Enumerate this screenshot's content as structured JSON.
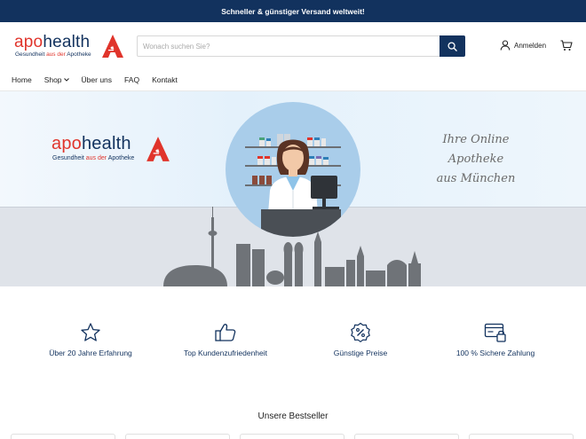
{
  "topbar": {
    "text": "Schneller & günstiger Versand weltweit!"
  },
  "header": {
    "logo": {
      "apo": "apo",
      "health": "health",
      "sub_a": "Gesundheit",
      "sub_b": "aus der",
      "sub_c": "Apotheke"
    },
    "search": {
      "placeholder": "Wonach suchen Sie?"
    },
    "login_label": "Anmelden"
  },
  "nav": {
    "items": [
      "Home",
      "Shop",
      "Über uns",
      "FAQ",
      "Kontakt"
    ]
  },
  "hero": {
    "logo": {
      "apo": "apo",
      "health": "health",
      "sub_a": "Gesundheit",
      "sub_b": "aus der",
      "sub_c": "Apotheke"
    },
    "slogan_line1": "Ihre Online Apotheke",
    "slogan_line2": "aus München"
  },
  "features": [
    {
      "label": "Über 20 Jahre Erfahrung",
      "icon": "star-icon"
    },
    {
      "label": "Top Kundenzufriedenheit",
      "icon": "thumbs-up-icon"
    },
    {
      "label": "Günstige Preise",
      "icon": "percent-badge-icon"
    },
    {
      "label": "100 % Sichere Zahlung",
      "icon": "secure-payment-icon"
    }
  ],
  "bestseller_title": "Unsere Bestseller",
  "colors": {
    "navy": "#12325e",
    "brand_red": "#e0342b",
    "hero_circle": "#a9cdea"
  }
}
